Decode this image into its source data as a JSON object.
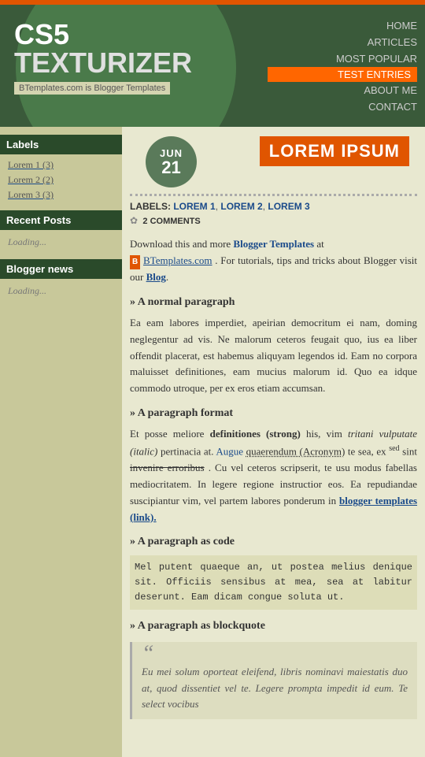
{
  "header": {
    "logo_cs5": "CS5",
    "logo_texturizer": "TEXTURIZER",
    "tagline": "BTemplates.com is Blogger Templates"
  },
  "nav": {
    "items": [
      {
        "label": "HOME",
        "active": false
      },
      {
        "label": "ARTICLES",
        "active": false
      },
      {
        "label": "MOST POPULAR",
        "active": false
      },
      {
        "label": "TEST ENTRIES",
        "active": true
      },
      {
        "label": "ABOUT ME",
        "active": false
      },
      {
        "label": "CONTACT",
        "active": false
      }
    ]
  },
  "date": {
    "month": "JUN",
    "day": "21"
  },
  "post": {
    "title": "LOREM IPSUM",
    "labels_prefix": "LABELS:",
    "labels": [
      "LOREM 1",
      "LOREM 2",
      "LOREM 3"
    ],
    "comments_count": "2 COMMENTS",
    "body_intro": "Download this and more",
    "blogger_templates_link": "Blogger Templates",
    "body_mid": "at",
    "btemplates_link": "BTemplates.com",
    "body_after_link": ". For tutorials, tips and tricks about Blogger visit our",
    "blog_link": "Blog",
    "body_after_blog": ".",
    "section1_heading": "A normal paragraph",
    "section1_text": "Ea eam labores imperdiet, apeirian democritum ei nam, doming neglegentur ad vis. Ne malorum ceteros feugait quo, ius ea liber offendit placerat, est habemus aliquyam legendos id. Eam no corpora maluisset definitiones, eam mucius malorum id. Quo ea idque commodo utroque, per ex eros etiam accumsan.",
    "section2_heading": "A paragraph format",
    "section2_pre": "Et posse meliore",
    "section2_strong": "definitiones (strong)",
    "section2_after_strong": "his, vim",
    "section2_italic": "tritani vulputate (italic)",
    "section2_after_italic": "pertinacia at.",
    "section2_abbr_pre": "Augue",
    "section2_abbr": "quaerendum (Acronym)",
    "section2_after_abbr": "te sea, ex",
    "section2_sup": "sed",
    "section2_after_sup": "sint",
    "section2_strike": "invenire erroribus",
    "section2_after_strike": ". Cu vel ceteros scripserit, te usu modus fabellas mediocritatem. In legere regione instructior eos. Ea repudiandae suscipiantur vim, vel partem labores ponderum in",
    "section2_link": "blogger templates (link).",
    "section3_heading": "A paragraph as code",
    "section3_text": "Mel putent quaeque an, ut postea melius denique sit. Officiis sensibus at mea, sea at labitur deserunt. Eam dicam congue soluta ut.",
    "section4_heading": "A paragraph as blockquote",
    "section4_quote_mark": "“",
    "section4_text": "Eu mei solum oporteat eleifend, libris nominavi maiestatis duo at, quod dissentiet vel te. Legere prompta impedit id eum. Te select vocibus"
  },
  "sidebar": {
    "labels_title": "Labels",
    "labels": [
      {
        "name": "Lorem 1",
        "count": "(3)"
      },
      {
        "name": "Lorem 2",
        "count": "(2)"
      },
      {
        "name": "Lorem 3",
        "count": "(3)"
      }
    ],
    "recent_title": "Recent Posts",
    "recent_loading": "Loading...",
    "news_title": "Blogger news",
    "news_loading": "Loading..."
  }
}
